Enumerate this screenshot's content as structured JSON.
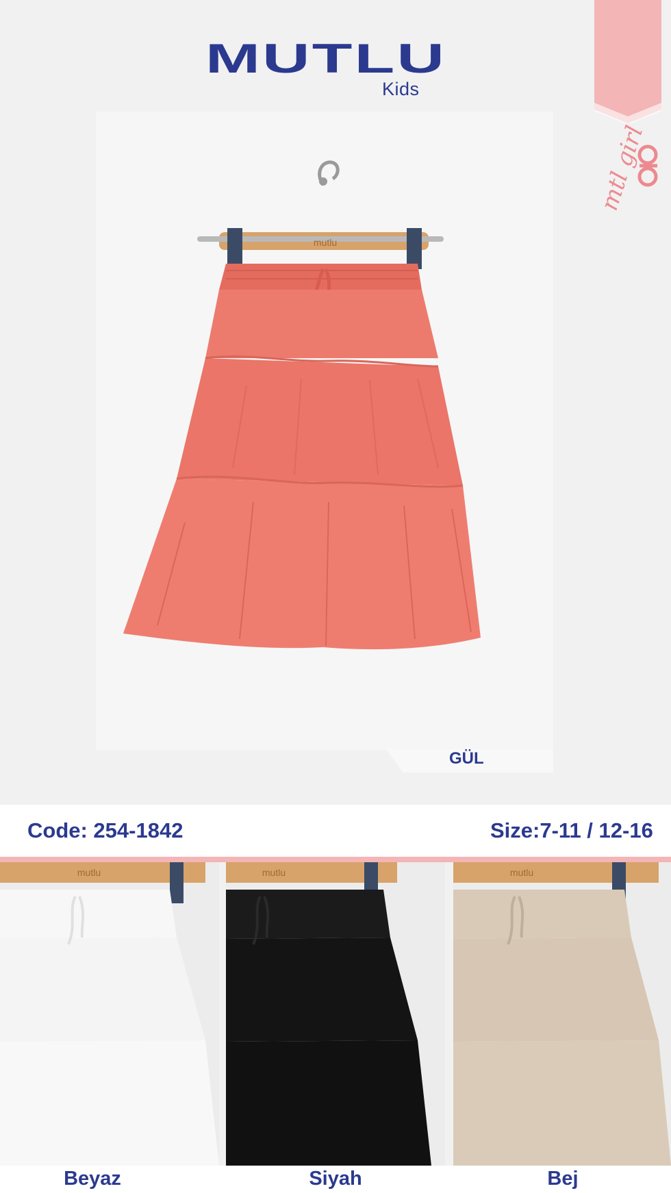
{
  "brand": {
    "name": "MUTLU",
    "sub": "Kids",
    "ribbon_text": "mtl girl"
  },
  "product": {
    "color_label": "GÜL",
    "code_text": "Code: 254-1842",
    "size_text": "Size:7-11 / 12-16",
    "hanger_brand": "mutlu"
  },
  "variants": [
    {
      "label": "Beyaz",
      "color": "#f4f4f4"
    },
    {
      "label": "Siyah",
      "color": "#141414"
    },
    {
      "label": "Bej",
      "color": "#d6c6b3"
    }
  ],
  "colors": {
    "brand_blue": "#2b3a8f",
    "accent_pink": "#f3b5b6",
    "skirt_main": "#ea7568",
    "background": "#f1f1f1"
  }
}
